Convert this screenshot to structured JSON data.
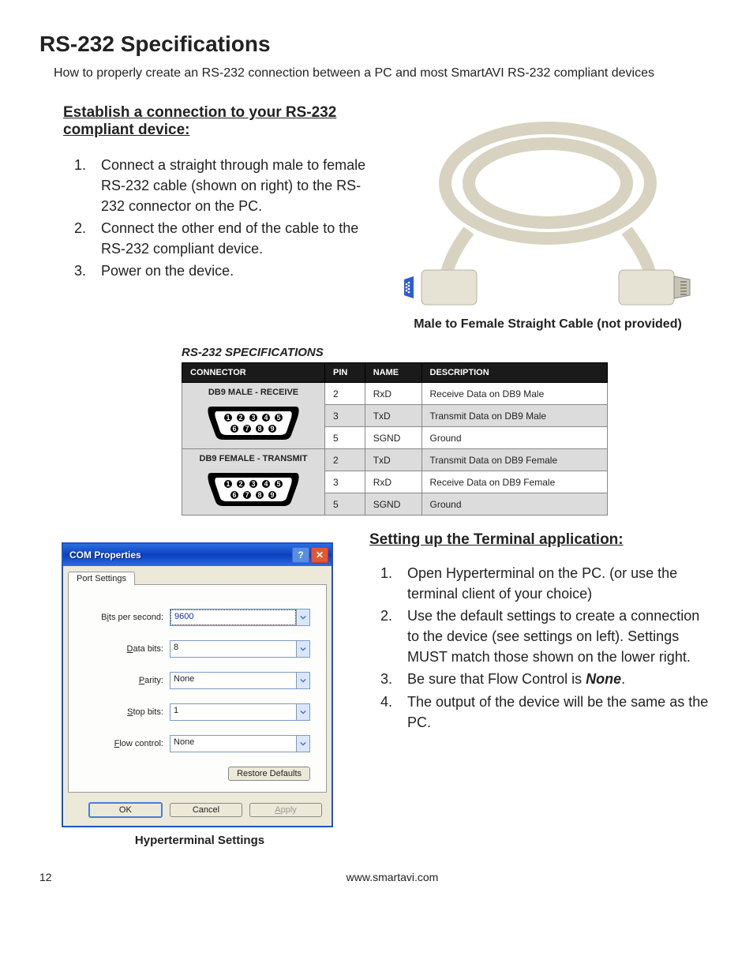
{
  "title": "RS-232 Specifications",
  "intro": "How to properly create an RS-232 connection between a PC and most SmartAVI RS-232 compliant devices",
  "section1": {
    "heading": "Establish a connection to your RS-232 compliant device:",
    "steps": [
      "Connect a straight through male to female RS-232 cable (shown on right) to the RS-232 connector on the PC.",
      "Connect the other end of the cable to the RS-232 compliant device.",
      "Power on the device."
    ]
  },
  "cable_caption": "Male to Female Straight Cable (not provided)",
  "spec": {
    "title": "RS-232 SPECIFICATIONS",
    "headers": [
      "CONNECTOR",
      "PIN",
      "NAME",
      "DESCRIPTION"
    ],
    "groups": [
      {
        "connector": "DB9 MALE - RECEIVE",
        "rows": [
          {
            "pin": "2",
            "name": "RxD",
            "desc": "Receive Data on DB9 Male"
          },
          {
            "pin": "3",
            "name": "TxD",
            "desc": "Transmit Data on DB9 Male"
          },
          {
            "pin": "5",
            "name": "SGND",
            "desc": "Ground"
          }
        ]
      },
      {
        "connector": "DB9 FEMALE - TRANSMIT",
        "rows": [
          {
            "pin": "2",
            "name": "TxD",
            "desc": "Transmit Data on DB9 Female"
          },
          {
            "pin": "3",
            "name": "RxD",
            "desc": "Receive Data on DB9 Female"
          },
          {
            "pin": "5",
            "name": "SGND",
            "desc": "Ground"
          }
        ]
      }
    ]
  },
  "dialog": {
    "title": "COM Properties",
    "tab": "Port Settings",
    "fields": {
      "bits_per_second": {
        "label_pre": "B",
        "label_ul": "i",
        "label_post": "ts per second:",
        "value": "9600"
      },
      "data_bits": {
        "label_pre": "",
        "label_ul": "D",
        "label_post": "ata bits:",
        "value": "8"
      },
      "parity": {
        "label_pre": "",
        "label_ul": "P",
        "label_post": "arity:",
        "value": "None"
      },
      "stop_bits": {
        "label_pre": "",
        "label_ul": "S",
        "label_post": "top bits:",
        "value": "1"
      },
      "flow_control": {
        "label_pre": "",
        "label_ul": "F",
        "label_post": "low control:",
        "value": "None"
      }
    },
    "restore": "Restore Defaults",
    "restore_ul": "R",
    "ok": "OK",
    "cancel": "Cancel",
    "apply": "Apply",
    "apply_ul": "A",
    "caption": "Hyperterminal Settings"
  },
  "section2": {
    "heading": "Setting up the Terminal application:",
    "steps": [
      "Open Hyperterminal on the PC. (or use the terminal client of your choice)",
      "Use the default settings to create a connection to the device (see settings on left). Settings MUST match those shown on the lower right.",
      "Be sure that Flow Control is ",
      " The output of the device will be the same as the PC."
    ],
    "step3_bold": "None"
  },
  "page_number": "12",
  "url": "www.smartavi.com"
}
